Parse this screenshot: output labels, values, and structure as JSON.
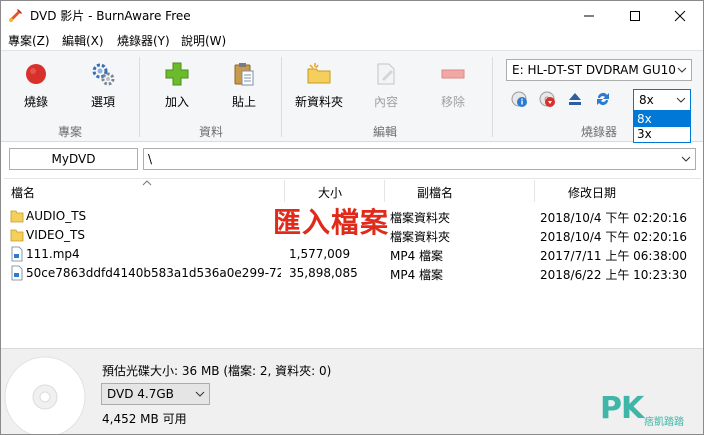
{
  "window": {
    "title": "DVD 影片 - BurnAware Free"
  },
  "menu": [
    "專案(Z)",
    "編輯(X)",
    "燒錄器(Y)",
    "說明(W)"
  ],
  "ribbon": {
    "buttons": {
      "burn": "燒錄",
      "options": "選項",
      "add": "加入",
      "paste": "貼上",
      "new_folder": "新資料夾",
      "content": "內容",
      "remove": "移除"
    },
    "groups": {
      "project": "專案",
      "data": "資料",
      "edit": "編輯",
      "burner": "燒錄器"
    },
    "drive": "E: HL-DT-ST DVDRAM GU10",
    "speed": {
      "selected": "8x",
      "options": [
        "8x",
        "3x"
      ]
    }
  },
  "path": {
    "disc_name": "MyDVD",
    "current_path": "\\"
  },
  "columns": {
    "name": "檔名",
    "size": "大小",
    "ext": "副檔名",
    "modified": "修改日期"
  },
  "files": [
    {
      "name": "AUDIO_TS",
      "size": "",
      "type": "檔案資料夾",
      "date": "2018/10/4 下午 02:20:16",
      "icon": "folder-icon"
    },
    {
      "name": "VIDEO_TS",
      "size": "",
      "type": "檔案資料夾",
      "date": "2018/10/4 下午 02:20:16",
      "icon": "folder-icon"
    },
    {
      "name": "111.mp4",
      "size": "1,577,009",
      "type": "MP4 檔案",
      "date": "2017/7/11 上午 06:38:00",
      "icon": "file-icon"
    },
    {
      "name": "50ce7863ddfd4140b583a1d536a0e299-72...",
      "size": "35,898,085",
      "type": "MP4 檔案",
      "date": "2018/6/22 上午 10:23:30",
      "icon": "file-icon"
    }
  ],
  "overlay": "匯入檔案",
  "status": {
    "estimate": "預估光碟大小: 36 MB (檔案: 2, 資料夾: 0)",
    "disc_type": "DVD 4.7GB",
    "available": "4,452 MB 可用"
  },
  "watermark": {
    "brand": "PK",
    "sub": "痞凱踏踏"
  },
  "colors": {
    "accent": "#0078d7",
    "overlay": "#e02b1c",
    "watermark": "#3fb6a8"
  }
}
